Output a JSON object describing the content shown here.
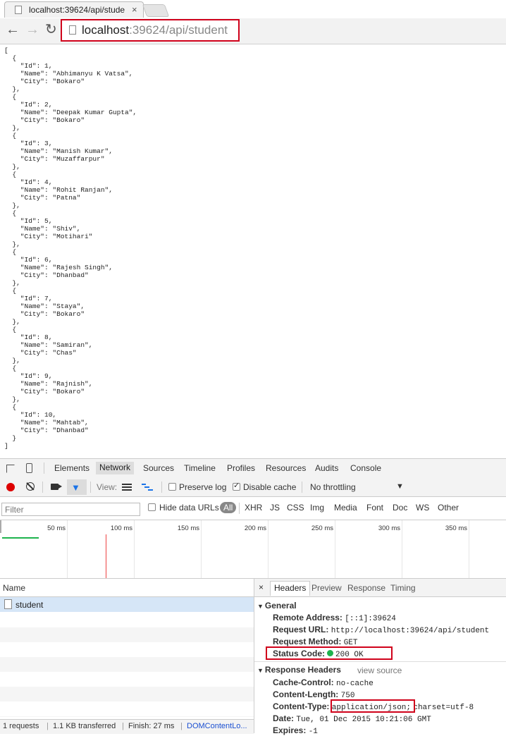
{
  "browser": {
    "tab_title": "localhost:39624/api/stude",
    "tab_close": "×",
    "url_host": "localhost",
    "url_rest": ":39624/api/student"
  },
  "json_text": "[\n  {\n    \"Id\": 1,\n    \"Name\": \"Abhimanyu K Vatsa\",\n    \"City\": \"Bokaro\"\n  },\n  {\n    \"Id\": 2,\n    \"Name\": \"Deepak Kumar Gupta\",\n    \"City\": \"Bokaro\"\n  },\n  {\n    \"Id\": 3,\n    \"Name\": \"Manish Kumar\",\n    \"City\": \"Muzaffarpur\"\n  },\n  {\n    \"Id\": 4,\n    \"Name\": \"Rohit Ranjan\",\n    \"City\": \"Patna\"\n  },\n  {\n    \"Id\": 5,\n    \"Name\": \"Shiv\",\n    \"City\": \"Motihari\"\n  },\n  {\n    \"Id\": 6,\n    \"Name\": \"Rajesh Singh\",\n    \"City\": \"Dhanbad\"\n  },\n  {\n    \"Id\": 7,\n    \"Name\": \"Staya\",\n    \"City\": \"Bokaro\"\n  },\n  {\n    \"Id\": 8,\n    \"Name\": \"Samiran\",\n    \"City\": \"Chas\"\n  },\n  {\n    \"Id\": 9,\n    \"Name\": \"Rajnish\",\n    \"City\": \"Bokaro\"\n  },\n  {\n    \"Id\": 10,\n    \"Name\": \"Mahtab\",\n    \"City\": \"Dhanbad\"\n  }\n]",
  "devtools": {
    "tabs": [
      "Elements",
      "Network",
      "Sources",
      "Timeline",
      "Profiles",
      "Resources",
      "Audits",
      "Console"
    ],
    "toolbar": {
      "view_label": "View:",
      "preserve_log": "Preserve log",
      "disable_cache": "Disable cache",
      "throttling": "No throttling"
    },
    "filter": {
      "placeholder": "Filter",
      "hide_data_urls": "Hide data URLs",
      "all": "All",
      "types": [
        "XHR",
        "JS",
        "CSS",
        "Img",
        "Media",
        "Font",
        "Doc",
        "WS",
        "Other"
      ]
    },
    "timeline_ticks": [
      "50 ms",
      "100 ms",
      "150 ms",
      "200 ms",
      "250 ms",
      "300 ms",
      "350 ms"
    ],
    "requests": {
      "header": "Name",
      "items": [
        "student"
      ]
    },
    "statusbar": {
      "requests": "1 requests",
      "transferred": "1.1 KB transferred",
      "finish": "Finish: 27 ms",
      "dom": "DOMContentLo..."
    },
    "details": {
      "close": "×",
      "tabs": [
        "Headers",
        "Preview",
        "Response",
        "Timing"
      ],
      "general_title": "General",
      "general": [
        {
          "k": "Remote Address:",
          "v": "[::1]:39624"
        },
        {
          "k": "Request URL:",
          "v": "http://localhost:39624/api/student"
        },
        {
          "k": "Request Method:",
          "v": "GET"
        },
        {
          "k": "Status Code:",
          "v": "200 OK"
        }
      ],
      "response_title": "Response Headers",
      "view_source": "view source",
      "response": [
        {
          "k": "Cache-Control:",
          "v": "no-cache"
        },
        {
          "k": "Content-Length:",
          "v": "750"
        },
        {
          "k": "Content-Type:",
          "v": "application/json;",
          "v2": "charset=utf-8"
        },
        {
          "k": "Date:",
          "v": "Tue, 01 Dec 2015 10:21:06 GMT"
        },
        {
          "k": "Expires:",
          "v": "-1"
        }
      ]
    }
  }
}
